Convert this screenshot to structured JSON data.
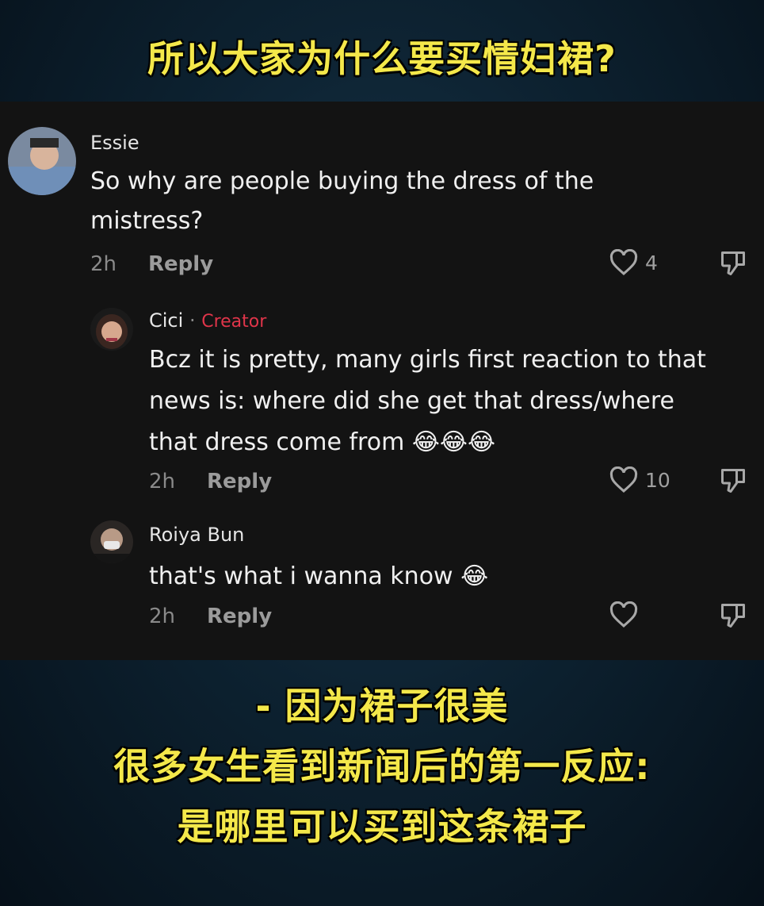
{
  "top_caption": "所以大家为什么要买情妇裙?",
  "comments": [
    {
      "author": "Essie",
      "text": "So why are people buying the dress of the mistress?",
      "text_line1": "So why are people buying the dress of the",
      "text_line2": "mistress?",
      "time": "2h",
      "reply_label": "Reply",
      "likes": "4"
    },
    {
      "author": "Cici",
      "separator": "·",
      "badge": "Creator",
      "text_line1": "Bcz it is pretty, many girls first reaction to that",
      "text_line2": "news is: where did she get that dress/where",
      "text_line3": "that dress come from",
      "emoji": "😂😂😂",
      "time": "2h",
      "reply_label": "Reply",
      "likes": "10"
    },
    {
      "author": "Roiya Bun",
      "text": "that's what i wanna know",
      "emoji": "😂",
      "time": "2h",
      "reply_label": "Reply",
      "likes": ""
    }
  ],
  "bottom_caption": {
    "line1": "- 因为裙子很美",
    "line2": "很多女生看到新闻后的第一反应:",
    "line3": "是哪里可以买到这条裙子"
  },
  "icons": [
    "heart-icon",
    "thumbs-down-icon"
  ],
  "colors": {
    "caption": "#f4e84a",
    "creator_badge": "#e0354a",
    "panel": "#131313"
  }
}
